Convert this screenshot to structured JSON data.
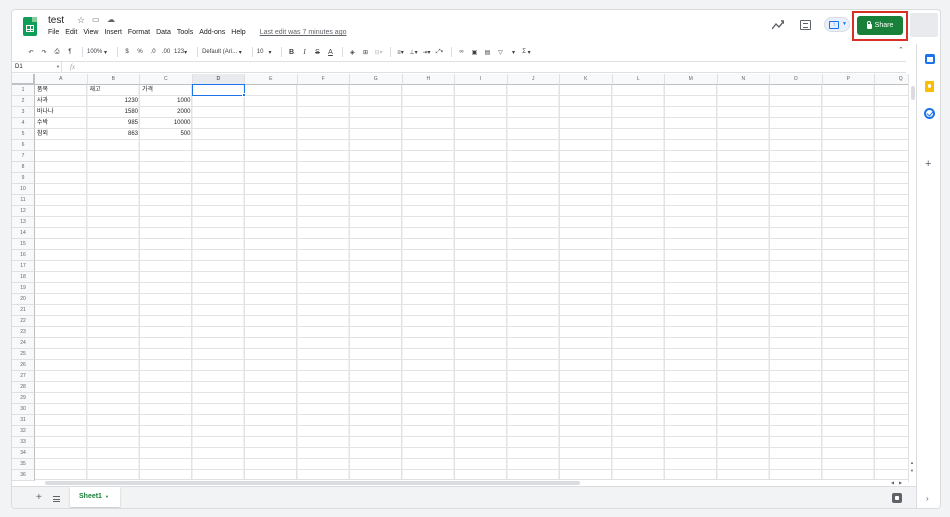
{
  "app": {
    "doc_title": "test",
    "menus": [
      "File",
      "Edit",
      "View",
      "Insert",
      "Format",
      "Data",
      "Tools",
      "Add-ons",
      "Help"
    ],
    "last_edit": "Last edit was 7 minutes ago",
    "share_label": "Share",
    "accent": "#188038",
    "highlight": "#d93025"
  },
  "toolbar": {
    "zoom": "100%",
    "currency": "$",
    "percent": "%",
    "decimal_dec": ".0",
    "decimal_inc": ".00",
    "more_formats": "123",
    "font": "Default (Ari...",
    "font_size": "10",
    "bold": "B",
    "italic": "I",
    "strike": "S",
    "text_color": "A",
    "sum": "Σ"
  },
  "formula_bar": {
    "name_box": "D1",
    "fx": "fx",
    "value": ""
  },
  "grid": {
    "columns": [
      "A",
      "B",
      "C",
      "D",
      "E",
      "F",
      "G",
      "H",
      "I",
      "J",
      "K",
      "L",
      "M",
      "N",
      "O",
      "P",
      "Q"
    ],
    "selected_column": "D",
    "row_count": 36,
    "rows": [
      [
        "품목",
        "재고",
        "가격"
      ],
      [
        "사과",
        "1230",
        "1000"
      ],
      [
        "바나나",
        "1580",
        "2000"
      ],
      [
        "수박",
        "985",
        "10000"
      ],
      [
        "참외",
        "863",
        "500"
      ]
    ],
    "selected_cell": "D1"
  },
  "sheets": {
    "tabs": [
      "Sheet1"
    ],
    "active": "Sheet1"
  },
  "side_panel": {
    "icons": [
      "calendar-icon",
      "keep-icon",
      "tasks-icon",
      "add-icon"
    ]
  }
}
